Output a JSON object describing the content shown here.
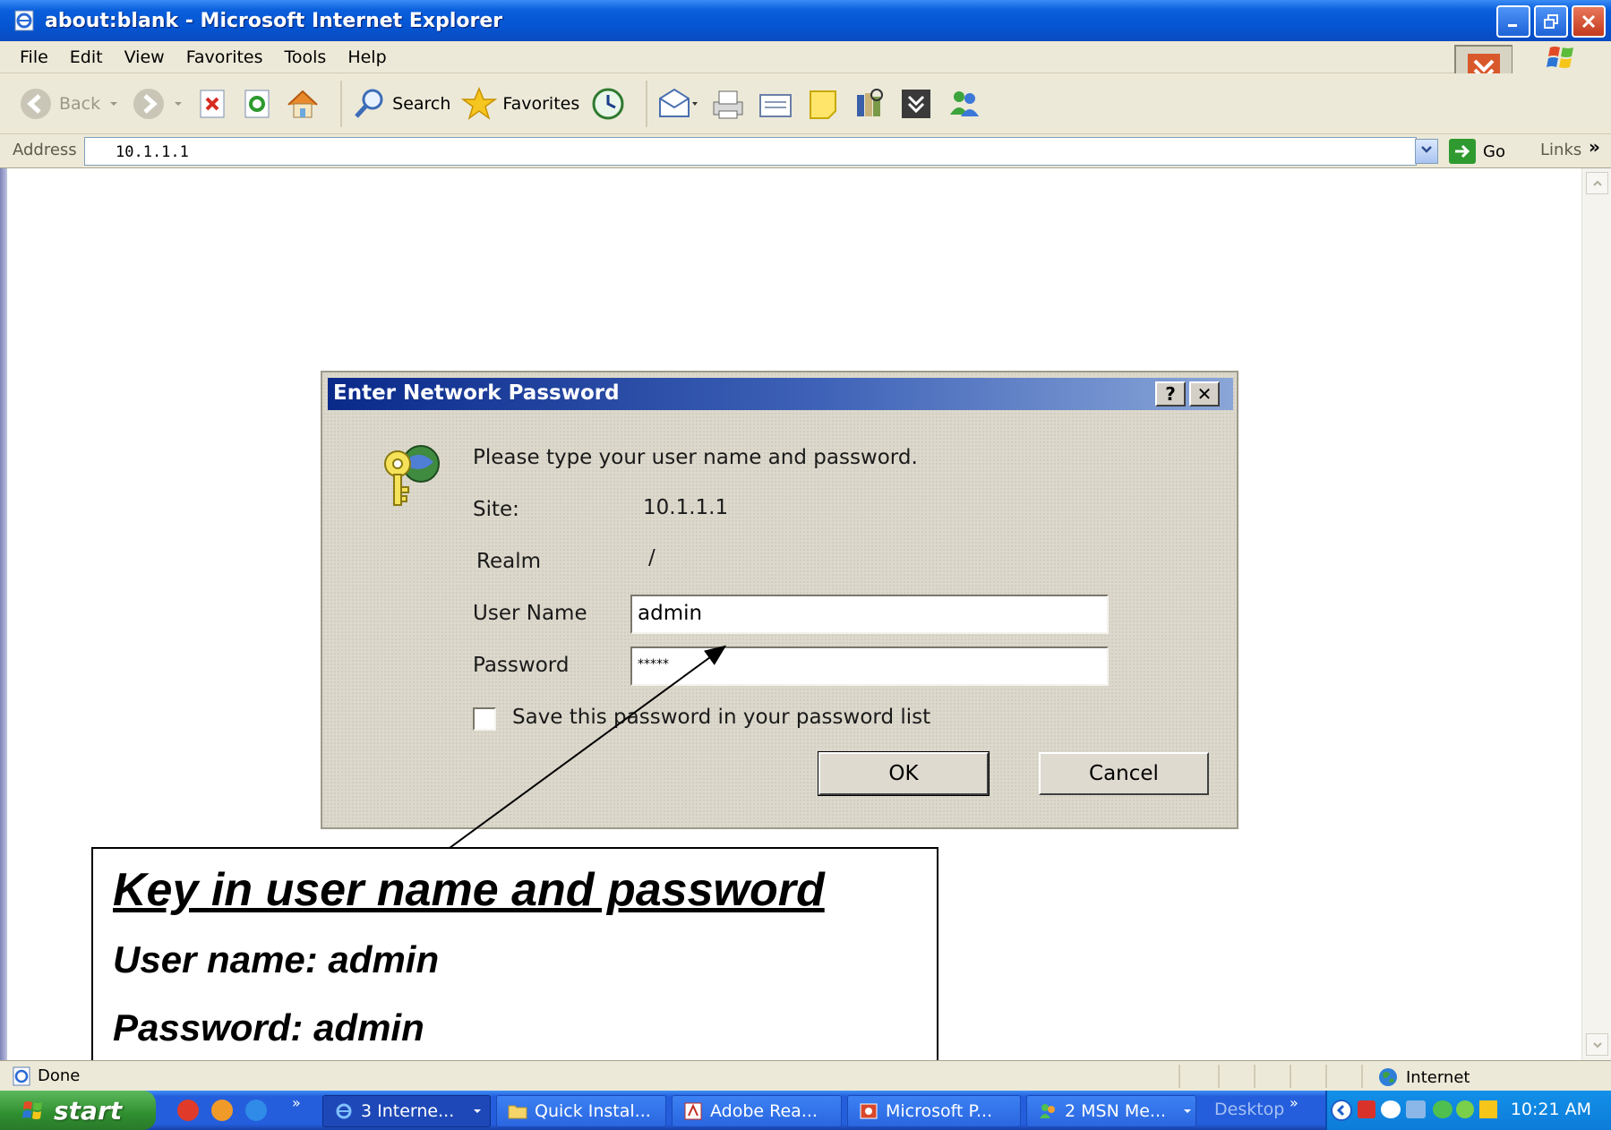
{
  "window": {
    "title": "about:blank - Microsoft Internet Explorer",
    "minimize_icon": "minimize-icon",
    "maximize_icon": "restore-icon",
    "close_icon": "close-icon"
  },
  "menu": [
    "File",
    "Edit",
    "View",
    "Favorites",
    "Tools",
    "Help"
  ],
  "toolbar": {
    "back_label": "Back",
    "search_label": "Search",
    "favorites_label": "Favorites"
  },
  "address": {
    "label": "Address",
    "value": "10.1.1.1",
    "go_label": "Go",
    "links_label": "Links",
    "links_chevron": "»"
  },
  "dialog": {
    "title": "Enter Network Password",
    "help_label": "?",
    "close_label": "✕",
    "prompt": "Please type your user name and password.",
    "site_label": "Site:",
    "site_value": "10.1.1.1",
    "realm_label": "Realm",
    "realm_value": "/",
    "username_label": "User Name",
    "username_value": "admin",
    "password_label": "Password",
    "password_value": "*****",
    "save_label": "Save this password in your password list",
    "save_checked": false,
    "ok_label": "OK",
    "cancel_label": "Cancel"
  },
  "callout": {
    "heading": "Key in user name and password",
    "line1": "User name: admin",
    "line2": "Password:  admin"
  },
  "status": {
    "text": "Done",
    "zone": "Internet"
  },
  "taskbar": {
    "start_label": "start",
    "quicklaunch_chevron": "»",
    "tasks": [
      {
        "label": "3 Interne...",
        "icon": "ie-icon",
        "active": true
      },
      {
        "label": "Quick Instal...",
        "icon": "folder-icon",
        "active": false
      },
      {
        "label": "Adobe Rea...",
        "icon": "adobe-reader-icon",
        "active": false
      },
      {
        "label": "Microsoft P...",
        "icon": "powerpoint-icon",
        "active": false
      },
      {
        "label": "2 MSN Me...",
        "icon": "msn-icon",
        "active": false
      }
    ],
    "desktop_label": "Desktop",
    "desktop_chevron": "»",
    "clock": "10:21 AM"
  },
  "colors": {
    "titlebar": "#0553d0",
    "dialog_title": "#0a2a8a",
    "taskbar": "#245edc",
    "start": "#2f8f2f"
  }
}
